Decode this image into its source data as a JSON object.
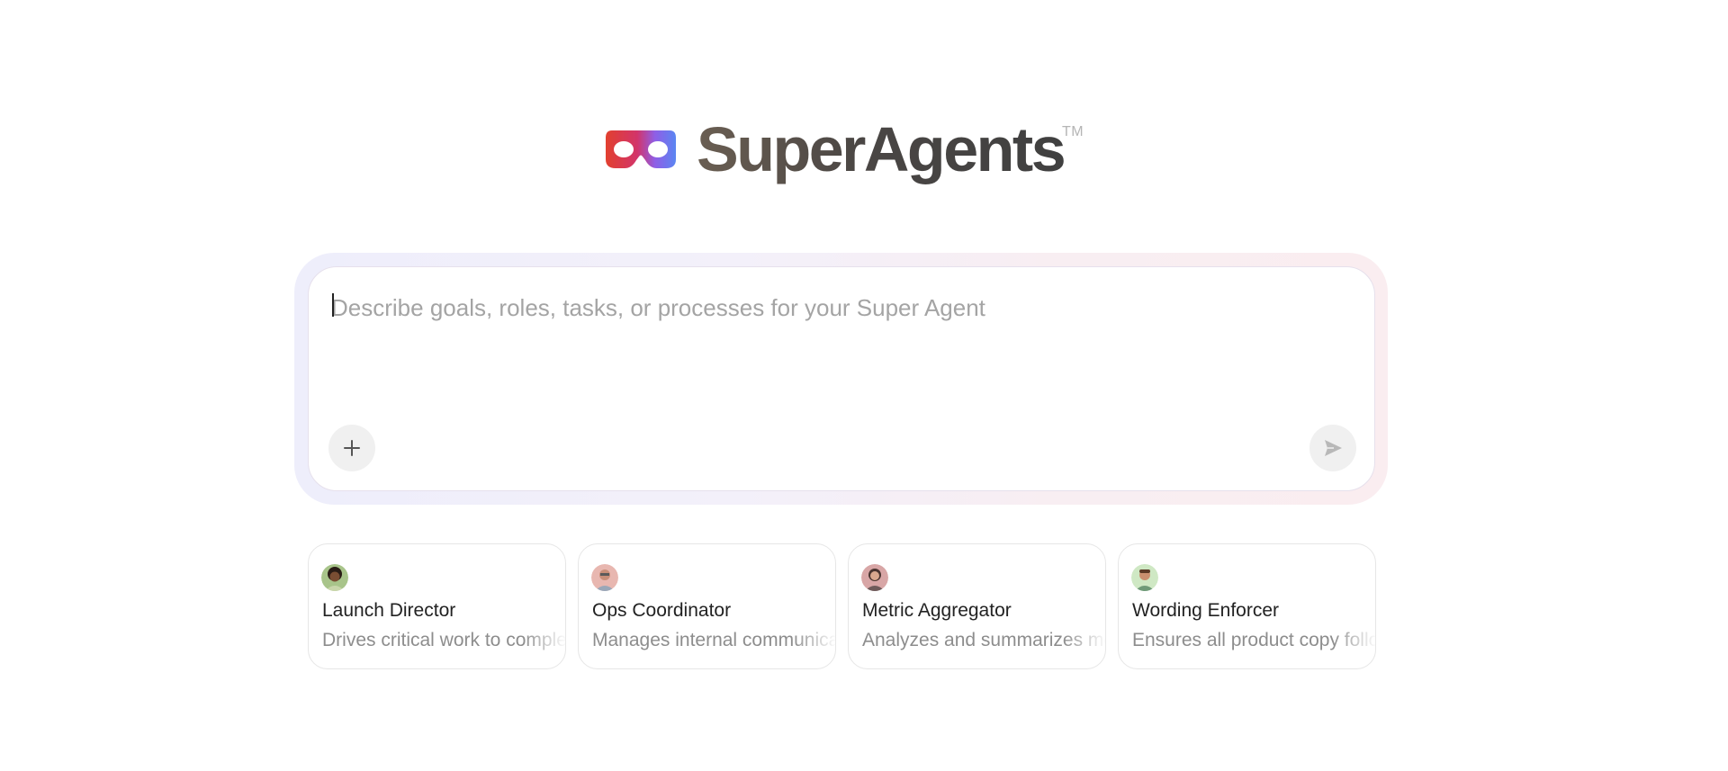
{
  "brand": {
    "name": "SuperAgents",
    "trademark": "TM",
    "logo_icon": "mask-icon"
  },
  "composer": {
    "placeholder": "Describe goals, roles, tasks, or processes for your Super Agent",
    "value": "",
    "add_icon": "plus-icon",
    "send_icon": "send-icon"
  },
  "agents": [
    {
      "name": "Launch Director",
      "description": "Drives critical work to completion",
      "avatar": "avatar-icon"
    },
    {
      "name": "Ops Coordinator",
      "description": "Manages internal communications",
      "avatar": "avatar-icon"
    },
    {
      "name": "Metric Aggregator",
      "description": "Analyzes and summarizes metrics",
      "avatar": "avatar-icon"
    },
    {
      "name": "Wording Enforcer",
      "description": "Ensures all product copy follows guidelines",
      "avatar": "avatar-icon"
    }
  ],
  "colors": {
    "logo_red": "#e2402f",
    "logo_blue": "#5b7ff0",
    "text_primary": "#222222",
    "text_muted": "#8d8d8d",
    "placeholder": "#a4a4a4"
  }
}
